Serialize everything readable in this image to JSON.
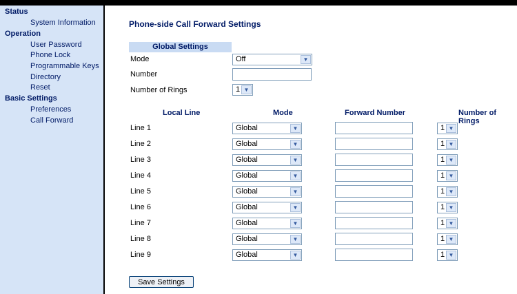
{
  "sidebar": {
    "status": {
      "heading": "Status",
      "items": [
        "System Information"
      ]
    },
    "operation": {
      "heading": "Operation",
      "items": [
        "User Password",
        "Phone Lock",
        "Programmable Keys",
        "Directory",
        "Reset"
      ]
    },
    "basic": {
      "heading": "Basic Settings",
      "items": [
        "Preferences",
        "Call Forward"
      ]
    }
  },
  "main": {
    "title": "Phone-side Call Forward Settings",
    "global": {
      "header": "Global Settings",
      "mode_label": "Mode",
      "mode_value": "Off",
      "number_label": "Number",
      "number_value": "",
      "rings_label": "Number of Rings",
      "rings_value": "1"
    },
    "columns": [
      "Local Line",
      "Mode",
      "Forward Number",
      "Number of Rings"
    ],
    "lines": [
      {
        "label": "Line 1",
        "mode": "Global",
        "forward": "",
        "rings": "1"
      },
      {
        "label": "Line 2",
        "mode": "Global",
        "forward": "",
        "rings": "1"
      },
      {
        "label": "Line 3",
        "mode": "Global",
        "forward": "",
        "rings": "1"
      },
      {
        "label": "Line 4",
        "mode": "Global",
        "forward": "",
        "rings": "1"
      },
      {
        "label": "Line 5",
        "mode": "Global",
        "forward": "",
        "rings": "1"
      },
      {
        "label": "Line 6",
        "mode": "Global",
        "forward": "",
        "rings": "1"
      },
      {
        "label": "Line 7",
        "mode": "Global",
        "forward": "",
        "rings": "1"
      },
      {
        "label": "Line 8",
        "mode": "Global",
        "forward": "",
        "rings": "1"
      },
      {
        "label": "Line 9",
        "mode": "Global",
        "forward": "",
        "rings": "1"
      }
    ],
    "save_label": "Save Settings"
  }
}
